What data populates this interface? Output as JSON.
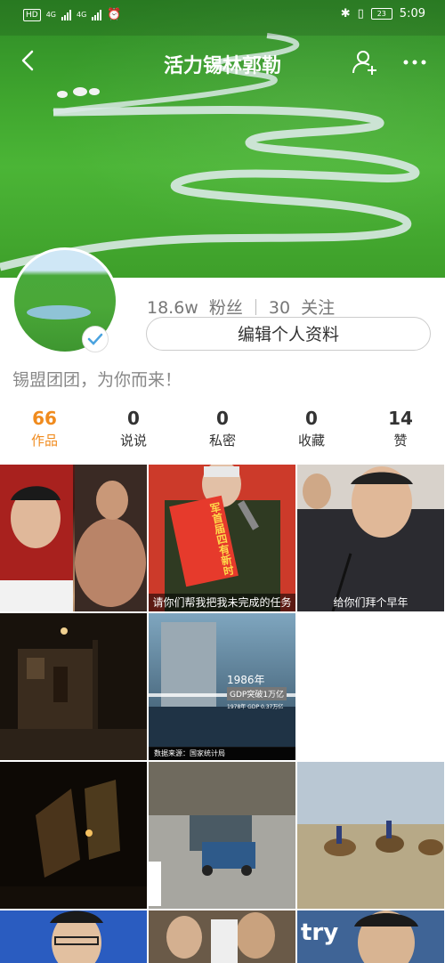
{
  "status_bar": {
    "hd": "HD",
    "net1": "4G",
    "net2": "4G",
    "battery": "23",
    "time": "5:09"
  },
  "header": {
    "title": "活力锡林郭勒"
  },
  "profile": {
    "fans_count": "18.6w",
    "fans_label": "粉丝",
    "following_count": "30",
    "following_label": "关注",
    "edit_button": "编辑个人资料",
    "bio": "锡盟团团，为你而来！"
  },
  "tabs": [
    {
      "count": "66",
      "label": "作品"
    },
    {
      "count": "0",
      "label": "说说"
    },
    {
      "count": "0",
      "label": "私密"
    },
    {
      "count": "0",
      "label": "收藏"
    },
    {
      "count": "14",
      "label": "赞"
    }
  ],
  "thumbnails": {
    "t3_caption": "请你们帮我把我未完成的任务",
    "t3_sash": "军首届四有新时",
    "t4_caption": "给你们拜个早年",
    "t6_year": "1986年",
    "t6_tag": "GDP突破1万亿",
    "t6_sub": "1978年  GDP 0.37万亿",
    "t6_source": "数据来源：国家统计局",
    "t11_text": "try"
  },
  "colors": {
    "accent": "#f08b1e",
    "banner_green": "#3fa52e"
  }
}
